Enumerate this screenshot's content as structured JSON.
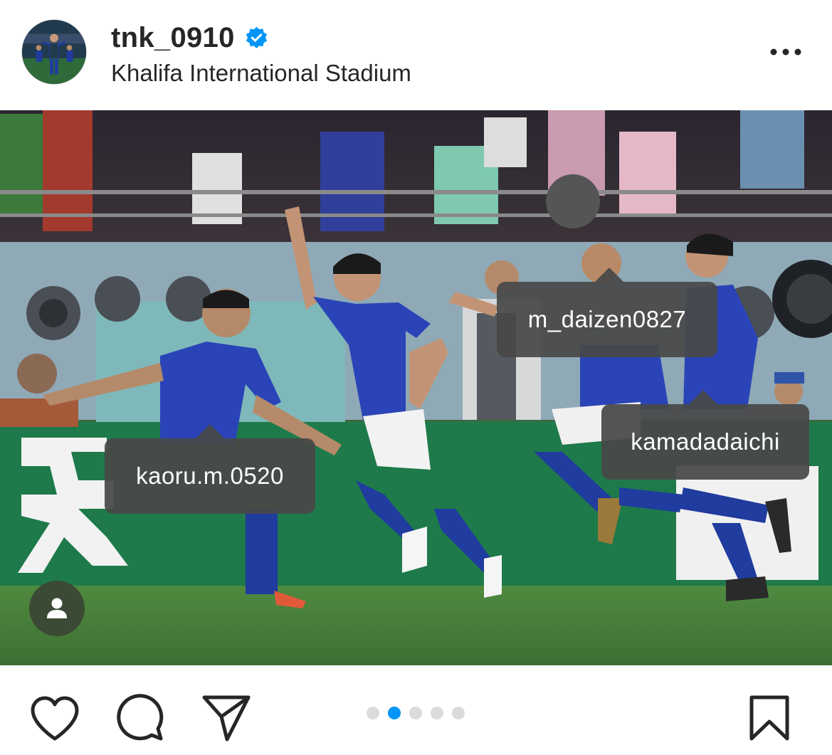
{
  "post": {
    "username": "tnk_0910",
    "verified": true,
    "location": "Khalifa International Stadium"
  },
  "icons": {
    "verified": "verified-badge-icon",
    "more": "more-options-icon",
    "tagged": "person-icon",
    "like": "heart-icon",
    "comment": "comment-icon",
    "share": "paper-plane-icon",
    "save": "bookmark-icon"
  },
  "tags": [
    {
      "username": "m_daizen0827"
    },
    {
      "username": "kamadadaichi"
    },
    {
      "username": "kaoru.m.0520"
    }
  ],
  "carousel": {
    "total": 5,
    "active_index": 2
  },
  "colors": {
    "accent": "#0095f6",
    "verified": "#0095f6",
    "text": "#262626"
  }
}
